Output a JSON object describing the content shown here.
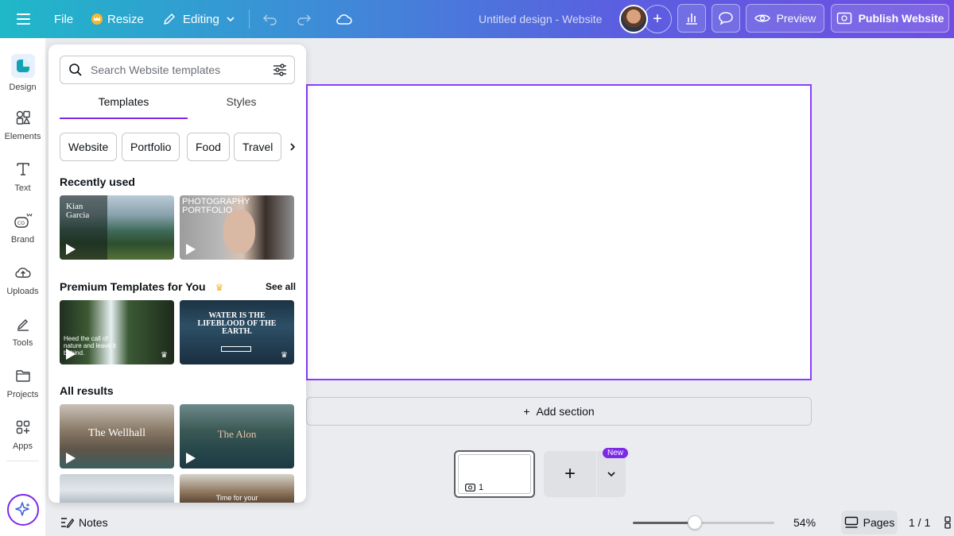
{
  "topbar": {
    "file": "File",
    "resize": "Resize",
    "editing": "Editing",
    "doc_title": "Untitled design - Website",
    "preview": "Preview",
    "publish": "Publish Website"
  },
  "rail": {
    "items": [
      {
        "label": "Design"
      },
      {
        "label": "Elements"
      },
      {
        "label": "Text"
      },
      {
        "label": "Brand"
      },
      {
        "label": "Uploads"
      },
      {
        "label": "Tools"
      },
      {
        "label": "Projects"
      },
      {
        "label": "Apps"
      }
    ]
  },
  "panel": {
    "search_placeholder": "Search Website templates",
    "tabs": [
      {
        "label": "Templates"
      },
      {
        "label": "Styles"
      }
    ],
    "chips": [
      {
        "label": "Website"
      },
      {
        "label": "Portfolio"
      },
      {
        "label": "Food"
      },
      {
        "label": "Travel"
      }
    ],
    "recently_used": "Recently used",
    "premium": "Premium Templates for You",
    "see_all": "See all",
    "all_results": "All results",
    "thumbs": {
      "kian": "Kian Garcia",
      "photo": "PHOTOGRAPHY PORTFOLIO",
      "heed": "Heed the call of nature and leave it behind.",
      "water": "WATER IS THE LIFEBLOOD OF THE EARTH.",
      "wellhall": "The Wellhall",
      "alon": "The Alon",
      "time": "Time for your"
    }
  },
  "canvas": {
    "add_section": "Add section",
    "page_number": "1",
    "new_badge": "New"
  },
  "bottom": {
    "notes": "Notes",
    "zoom": "54%",
    "zoom_level": 0.44,
    "pages": "Pages",
    "page_count": "1 / 1"
  }
}
